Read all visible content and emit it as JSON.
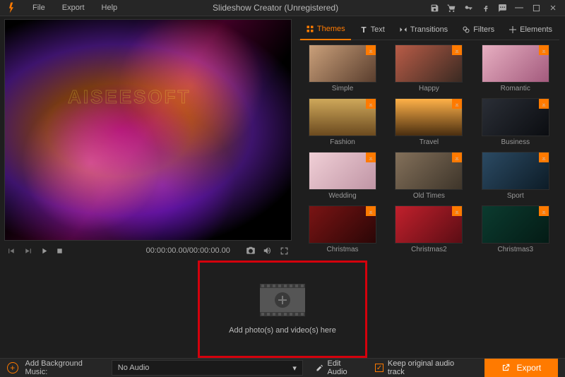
{
  "app": {
    "title": "Slideshow Creator (Unregistered)",
    "watermark": "AISEESOFT"
  },
  "menu": {
    "file": "File",
    "export": "Export",
    "help": "Help"
  },
  "win_icons": {
    "save": "save-icon",
    "cart": "cart-icon",
    "key": "key-icon",
    "fb": "facebook-icon",
    "feedback": "feedback-icon",
    "min": "minimize-icon",
    "max": "maximize-icon",
    "close": "close-icon"
  },
  "player": {
    "timecode": "00:00:00.00/00:00:00.00"
  },
  "tabs": [
    {
      "id": "themes",
      "label": "Themes",
      "active": true
    },
    {
      "id": "text",
      "label": "Text",
      "active": false
    },
    {
      "id": "transitions",
      "label": "Transitions",
      "active": false
    },
    {
      "id": "filters",
      "label": "Filters",
      "active": false
    },
    {
      "id": "elements",
      "label": "Elements",
      "active": false
    }
  ],
  "themes": [
    {
      "label": "Simple",
      "cls": "tSimple"
    },
    {
      "label": "Happy",
      "cls": "tHappy"
    },
    {
      "label": "Romantic",
      "cls": "tRomantic"
    },
    {
      "label": "Fashion",
      "cls": "tFashion"
    },
    {
      "label": "Travel",
      "cls": "tTravel"
    },
    {
      "label": "Business",
      "cls": "tBusiness"
    },
    {
      "label": "Wedding",
      "cls": "tWedding"
    },
    {
      "label": "Old Times",
      "cls": "tOld"
    },
    {
      "label": "Sport",
      "cls": "tSport"
    },
    {
      "label": "Christmas",
      "cls": "tChristmas1"
    },
    {
      "label": "Christmas2",
      "cls": "tChristmas2"
    },
    {
      "label": "Christmas3",
      "cls": "tChristmas3"
    }
  ],
  "dropzone": {
    "text": "Add photo(s) and video(s) here"
  },
  "footer": {
    "add_bg_label": "Add Background Music:",
    "audio_select_value": "No Audio",
    "edit_audio": "Edit Audio",
    "keep_original": "Keep original audio track",
    "export": "Export"
  }
}
